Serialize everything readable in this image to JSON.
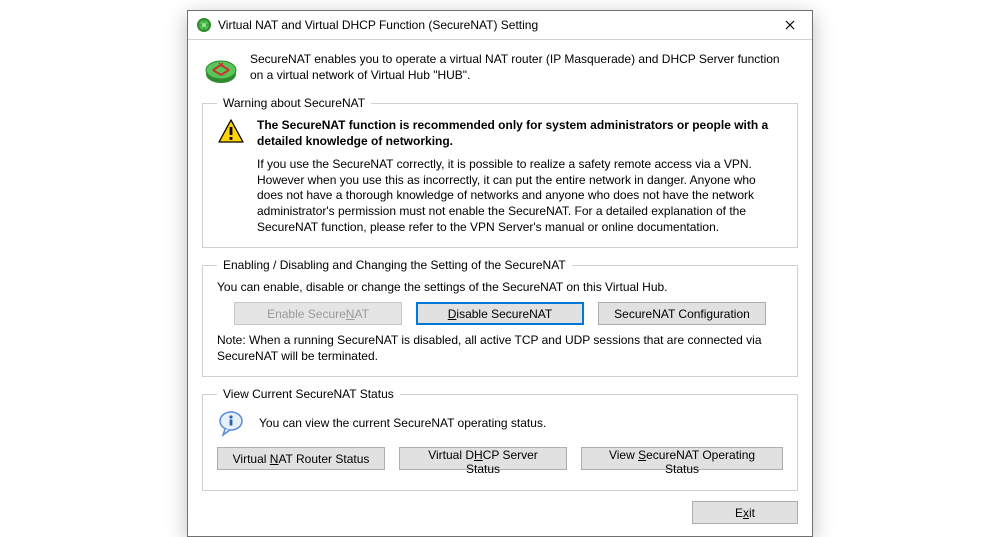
{
  "window": {
    "title": "Virtual NAT and Virtual DHCP Function (SecureNAT) Setting"
  },
  "intro": {
    "text": "SecureNAT enables you to operate a virtual NAT router (IP Masquerade) and DHCP Server function on a virtual network of Virtual Hub \"HUB\"."
  },
  "warning_group": {
    "legend": "Warning about SecureNAT",
    "bold": "The SecureNAT function is recommended only for system administrators or people with a detailed knowledge of networking.",
    "body": "If you use the SecureNAT correctly, it is possible to realize a safety remote access via a VPN. However when you use this as incorrectly, it can put the entire network in danger. Anyone who does not have a thorough knowledge of networks and anyone who does not have the network administrator's permission must not enable the SecureNAT. For a detailed explanation of the SecureNAT function, please refer to the VPN Server's manual or online documentation."
  },
  "enable_group": {
    "legend": "Enabling / Disabling and Changing the Setting of the SecureNAT",
    "desc": "You can enable, disable or change the settings of the SecureNAT on this Virtual Hub.",
    "btn_enable_pre": "Enable Secure",
    "btn_enable_u": "N",
    "btn_enable_post": "AT",
    "btn_disable_u": "D",
    "btn_disable_post": "isable SecureNAT",
    "btn_config": "SecureNAT Configuration",
    "note": "Note: When a running SecureNAT is disabled, all active TCP and UDP sessions that are connected via SecureNAT will be terminated."
  },
  "status_group": {
    "legend": "View Current SecureNAT Status",
    "desc": "You can view the current SecureNAT operating status.",
    "btn_nat_pre": "Virtual ",
    "btn_nat_u": "N",
    "btn_nat_post": "AT Router Status",
    "btn_dhcp_pre": "Virtual D",
    "btn_dhcp_u": "H",
    "btn_dhcp_post": "CP Server Status",
    "btn_op_pre": "View ",
    "btn_op_u": "S",
    "btn_op_post": "ecureNAT Operating Status"
  },
  "footer": {
    "exit_pre": "E",
    "exit_u": "x",
    "exit_post": "it"
  }
}
